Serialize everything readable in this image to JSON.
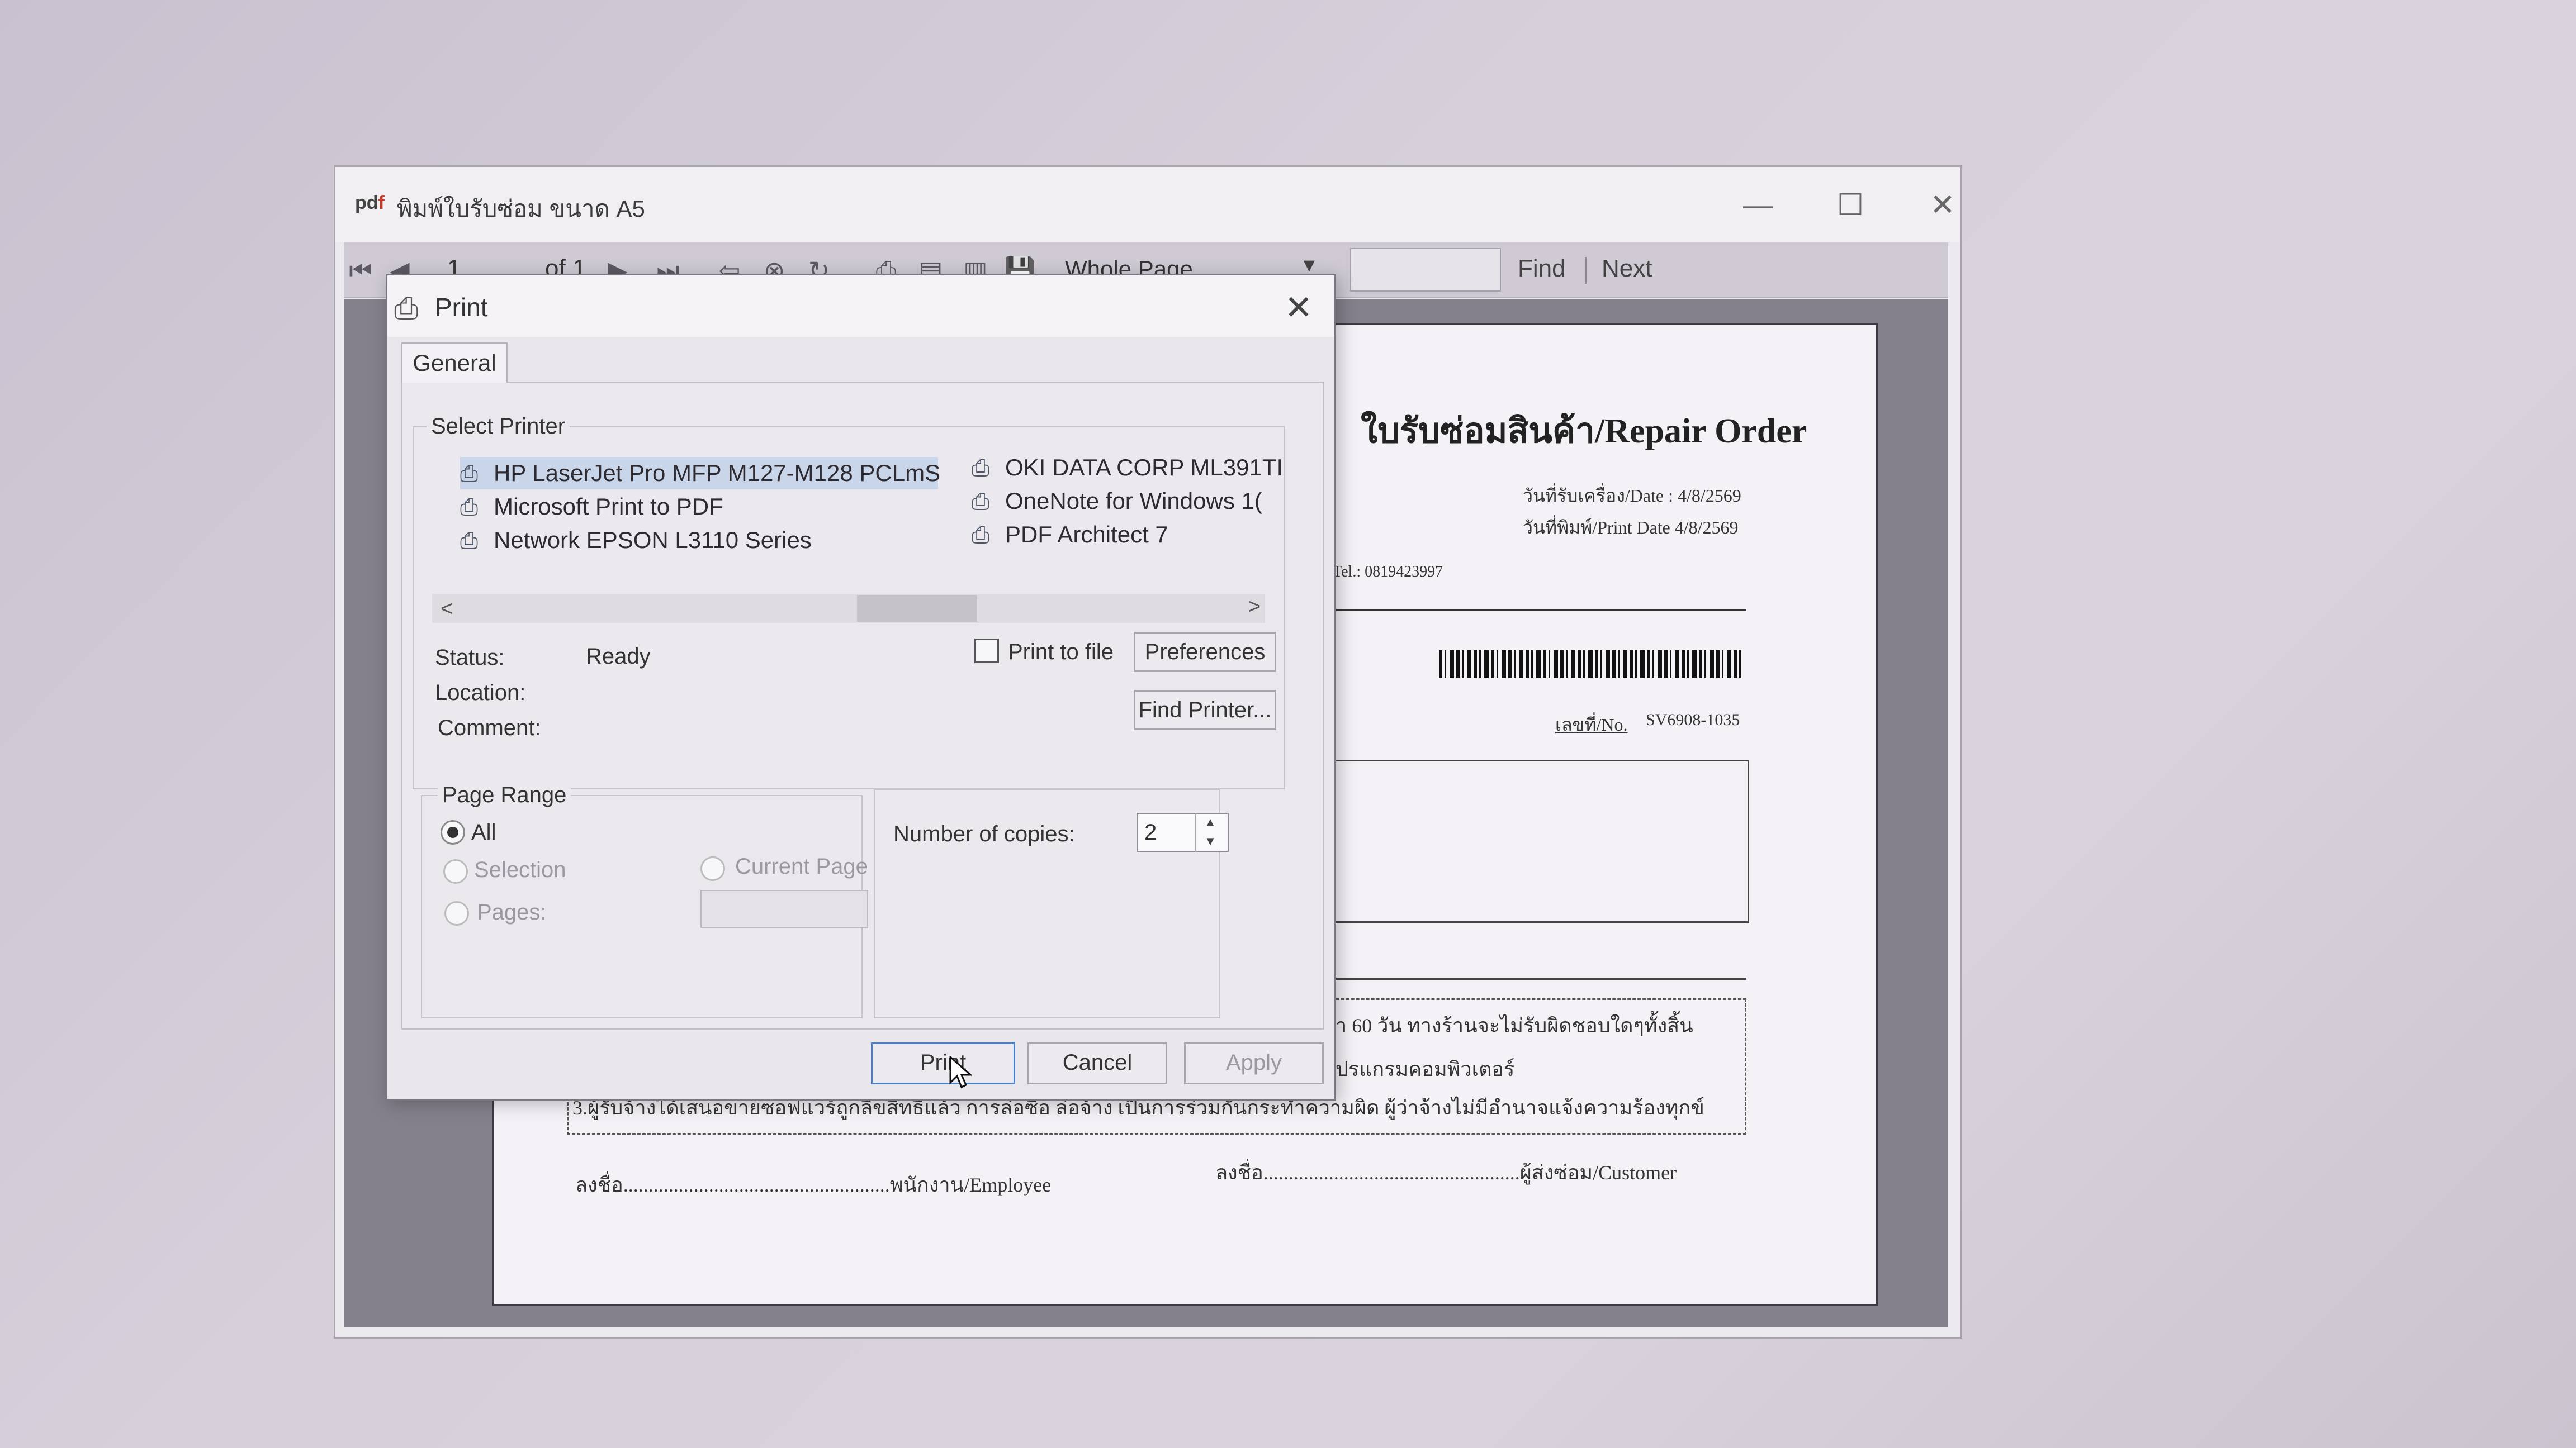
{
  "viewer": {
    "app_icon": "pdf-logo-icon",
    "title": "พิมพ์ใบรับซ่อม ขนาด A5",
    "window_controls": {
      "minimize": "—",
      "maximize": "☐",
      "close": "✕"
    },
    "toolbar": {
      "page_number": "1",
      "page_of": "of 1",
      "zoom": "Whole Page",
      "find_label": "Find",
      "next_label": "Next",
      "find_value": ""
    }
  },
  "document": {
    "title": "ใบรับซ่อมสินค้า/Repair Order",
    "date_received": "วันที่รับเครื่อง/Date : 4/8/2569",
    "date_printed": "วันที่พิมพ์/Print Date 4/8/2569",
    "tel": "Tel.: 0819423997",
    "no_label": "เลขที่/No.",
    "no_value": "SV6908-1035",
    "term1": "า 60 วัน ทางร้านจะไม่รับผิดชอบใดๆทั้งสิ้น",
    "term2": "ปรแกรมคอมพิวเตอร์",
    "term3": "3.ผู้รับจ้างได้เสนอขายซอฟแวร์ถูกลิขสิทธิ์แล้ว การล่อซื้อ ล่อจ้าง เป็นการร่วมกันกระทำความผิด ผู้ว่าจ้างไม่มีอำนาจแจ้งความร้องทุกข์",
    "sign_employee": "ลงชื่อ.....................................................พนักงาน/Employee",
    "sign_customer": "ลงชื่อ...................................................ผู้ส่งซ่อม/Customer"
  },
  "dialog": {
    "title": "Print",
    "tab": "General",
    "select_printer_label": "Select Printer",
    "printers_col1": [
      {
        "name": "HP LaserJet Pro MFP M127-M128 PCLmS",
        "selected": true,
        "icon": "printer-default-icon"
      },
      {
        "name": "Microsoft Print to PDF",
        "selected": false,
        "icon": "printer-icon"
      },
      {
        "name": "Network EPSON L3110 Series",
        "selected": false,
        "icon": "printer-icon"
      }
    ],
    "printers_col2": [
      {
        "name": "OKI DATA CORP ML391TI",
        "selected": false,
        "icon": "printer-icon"
      },
      {
        "name": "OneNote for Windows 1(",
        "selected": false,
        "icon": "printer-icon"
      },
      {
        "name": "PDF Architect 7",
        "selected": false,
        "icon": "printer-icon"
      }
    ],
    "status_label": "Status:",
    "status_value": "Ready",
    "location_label": "Location:",
    "comment_label": "Comment:",
    "print_to_file_label": "Print to file",
    "print_to_file_checked": false,
    "preferences_button": "Preferences",
    "find_printer_button": "Find Printer...",
    "page_range_label": "Page Range",
    "range_all": "All",
    "range_selection": "Selection",
    "range_current_page": "Current Page",
    "range_pages": "Pages:",
    "range_selected": "All",
    "copies_label": "Number of copies:",
    "copies_value": "2",
    "print_button": "Print",
    "cancel_button": "Cancel",
    "apply_button": "Apply"
  }
}
